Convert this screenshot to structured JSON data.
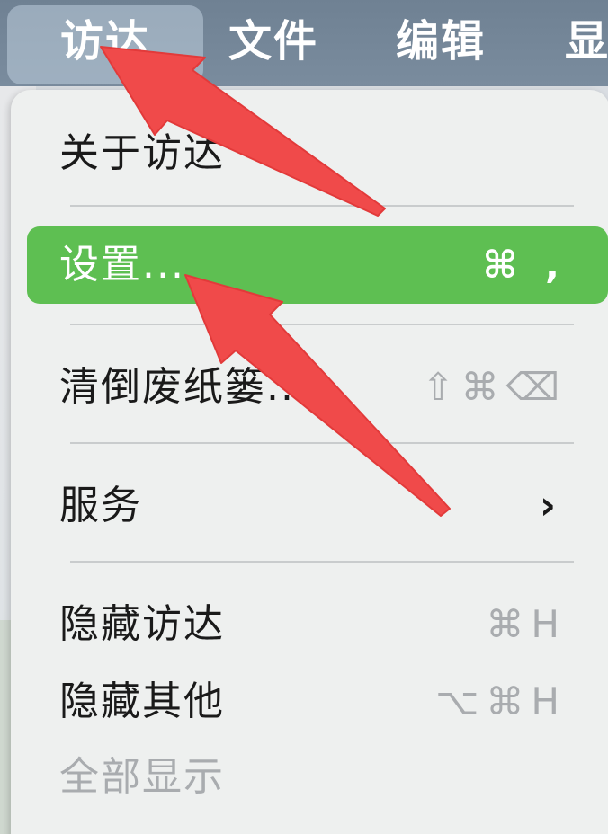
{
  "menubar": {
    "items": [
      {
        "label": "访达",
        "active": true
      },
      {
        "label": "文件"
      },
      {
        "label": "编辑"
      },
      {
        "label": "显"
      }
    ]
  },
  "menu": {
    "items": [
      {
        "label": "关于访达",
        "shortcut": ""
      },
      {
        "label": "设置...",
        "shortcut": "⌘ ,",
        "highlighted": true
      },
      {
        "label": "清倒废纸篓...",
        "shortcut": "⇧⌘⌫"
      },
      {
        "label": "服务",
        "submenu_icon": "chevron-right-icon"
      },
      {
        "label": "隐藏访达",
        "shortcut": "⌘H"
      },
      {
        "label": "隐藏其他",
        "shortcut": "⌥⌘H"
      },
      {
        "label": "全部显示",
        "shortcut": "",
        "disabled": true
      }
    ]
  },
  "colors": {
    "highlight": "#5ebf52",
    "menubar": "#738597",
    "menu_bg": "#eef0ef",
    "arrow": "#f04a4a"
  },
  "annotations": {
    "arrow_icon": "red-arrow-icon"
  }
}
